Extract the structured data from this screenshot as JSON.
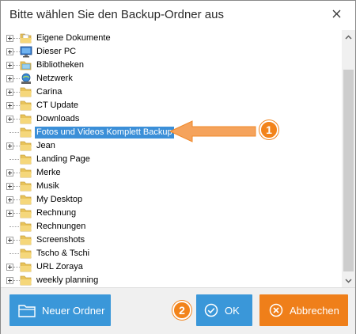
{
  "window": {
    "title": "Bitte wählen Sie den Backup-Ordner aus",
    "close_glyph": "close-icon"
  },
  "tree": {
    "items": [
      {
        "label": "Eigene Dokumente",
        "icon": "documents-folder-icon",
        "expandable": true,
        "selected": false
      },
      {
        "label": "Dieser PC",
        "icon": "computer-icon",
        "expandable": true,
        "selected": false
      },
      {
        "label": "Bibliotheken",
        "icon": "libraries-icon",
        "expandable": true,
        "selected": false
      },
      {
        "label": "Netzwerk",
        "icon": "network-icon",
        "expandable": true,
        "selected": false
      },
      {
        "label": "Carina",
        "icon": "folder-icon",
        "expandable": true,
        "selected": false
      },
      {
        "label": "CT Update",
        "icon": "folder-icon",
        "expandable": true,
        "selected": false
      },
      {
        "label": "Downloads",
        "icon": "folder-icon",
        "expandable": true,
        "selected": false
      },
      {
        "label": "Fotos und Videos Komplett Backup",
        "icon": "folder-icon",
        "expandable": false,
        "selected": true
      },
      {
        "label": "Jean",
        "icon": "folder-icon",
        "expandable": true,
        "selected": false
      },
      {
        "label": "Landing Page",
        "icon": "folder-icon",
        "expandable": false,
        "selected": false
      },
      {
        "label": "Merke",
        "icon": "folder-icon",
        "expandable": true,
        "selected": false
      },
      {
        "label": "Musik",
        "icon": "folder-icon",
        "expandable": true,
        "selected": false
      },
      {
        "label": "My Desktop",
        "icon": "folder-icon",
        "expandable": true,
        "selected": false
      },
      {
        "label": "Rechnung",
        "icon": "folder-icon",
        "expandable": true,
        "selected": false
      },
      {
        "label": "Rechnungen",
        "icon": "folder-icon",
        "expandable": false,
        "selected": false
      },
      {
        "label": "Screenshots",
        "icon": "folder-icon",
        "expandable": true,
        "selected": false
      },
      {
        "label": "Tscho & Tschi",
        "icon": "folder-icon",
        "expandable": false,
        "selected": false
      },
      {
        "label": "URL Zoraya",
        "icon": "folder-icon",
        "expandable": true,
        "selected": false
      },
      {
        "label": "weekly planning",
        "icon": "folder-icon",
        "expandable": true,
        "selected": false
      }
    ]
  },
  "annotations": {
    "badge_1": "1",
    "badge_2": "2"
  },
  "buttons": {
    "new_folder": "Neuer Ordner",
    "ok": "OK",
    "cancel": "Abbrechen"
  },
  "colors": {
    "accent_blue": "#3a97d9",
    "accent_orange": "#ef7f1a",
    "selection": "#3b8fd8"
  }
}
